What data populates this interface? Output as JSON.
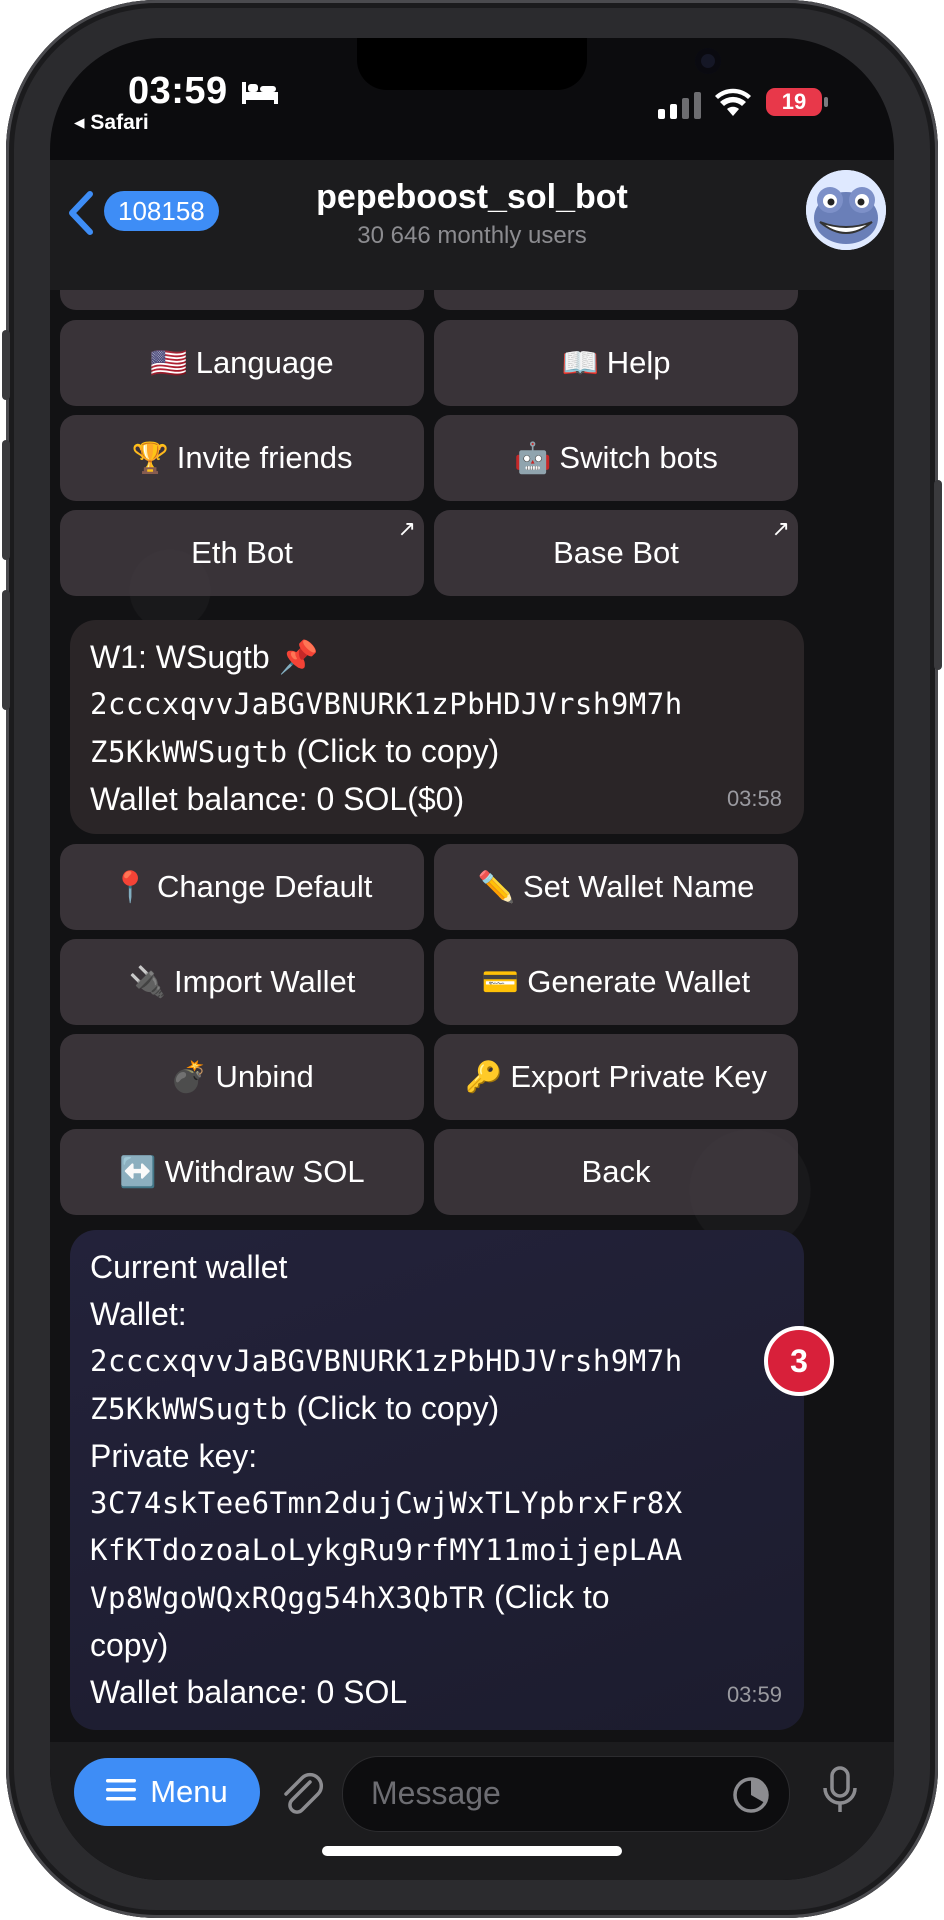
{
  "status_bar": {
    "time": "03:59",
    "back_app": "Safari",
    "battery": "19"
  },
  "header": {
    "unread_count": "108158",
    "title": "pepeboost_sol_bot",
    "subtitle": "30 646 monthly users"
  },
  "keyboard_top": [
    {
      "emoji": "🇺🇸",
      "label": "Language"
    },
    {
      "emoji": "📖",
      "label": "Help"
    },
    {
      "emoji": "🏆",
      "label": "Invite friends"
    },
    {
      "emoji": "🤖",
      "label": "Switch bots"
    },
    {
      "emoji": "",
      "label": "Eth Bot"
    },
    {
      "emoji": "",
      "label": "Base Bot"
    }
  ],
  "message1": {
    "line1": "W1: WSugtb 📌",
    "address_1": "2cccxqvvJaBGVBNURK1zPbHDJVrsh9M7h",
    "address_2": "Z5KkWWSugtb",
    "copy_hint": "(Click to copy)",
    "balance": "Wallet balance: 0 SOL($0)",
    "time": "03:58"
  },
  "keyboard_wallet": [
    {
      "emoji": "📍",
      "label": "Change Default"
    },
    {
      "emoji": "✏️",
      "label": "Set Wallet Name"
    },
    {
      "emoji": "🔌",
      "label": "Import Wallet"
    },
    {
      "emoji": "💳",
      "label": "Generate Wallet"
    },
    {
      "emoji": "💣",
      "label": "Unbind"
    },
    {
      "emoji": "🔑",
      "label": "Export Private Key"
    },
    {
      "emoji": "↔️",
      "label": "Withdraw SOL"
    },
    {
      "emoji": "",
      "label": "Back"
    }
  ],
  "message2": {
    "line1": "Current wallet",
    "line2": "Wallet:",
    "address_1": "2cccxqvvJaBGVBNURK1zPbHDJVrsh9M7h",
    "address_2": "Z5KkWWSugtb",
    "copy_hint": "(Click to copy)",
    "pk_label": "Private key:",
    "pk_1": "3C74skTee6Tmn2dujCwjWxTLYpbrxFr8X",
    "pk_2": "KfKTdozoaLoLykgRu9rfMY11moijepLAA",
    "pk_3": "Vp8WgoWQxRQgg54hX3QbTR",
    "pk_copy_hint_1": "(Click to",
    "pk_copy_hint_2": "copy)",
    "balance": "Wallet balance: 0 SOL",
    "time": "03:59"
  },
  "unread_badge": "3",
  "input_bar": {
    "menu_label": "Menu",
    "placeholder": "Message"
  },
  "colors": {
    "accent": "#3e8df6",
    "badge": "#d8203a",
    "battery": "#e8384a"
  }
}
